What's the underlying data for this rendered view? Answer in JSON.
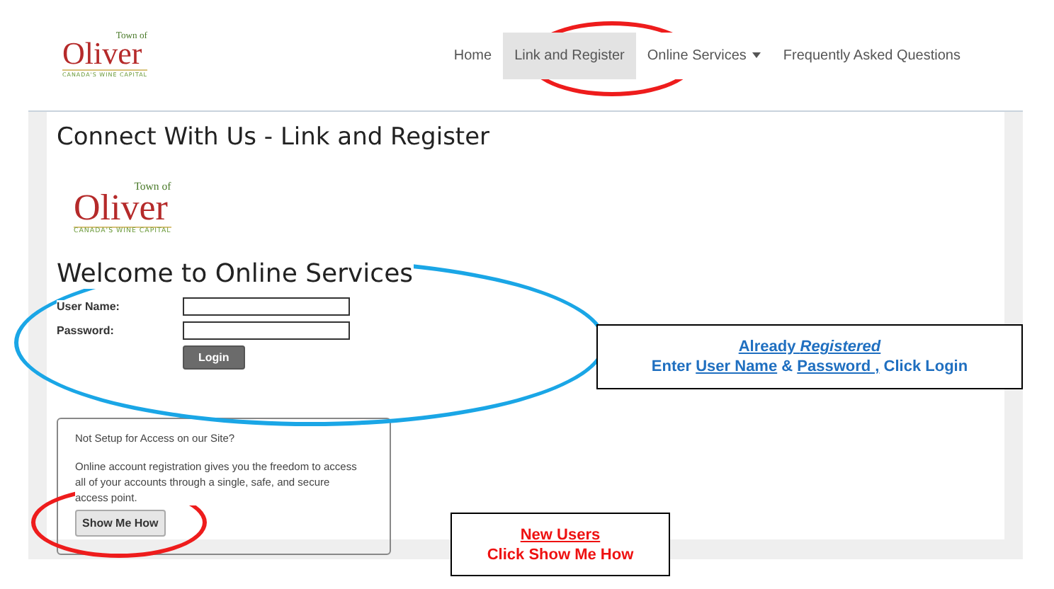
{
  "header": {
    "logo": {
      "town": "Town of",
      "name": "Oliver",
      "tagline": "CANADA'S WINE CAPITAL"
    },
    "nav": [
      {
        "label": "Home",
        "selected": false,
        "dropdown": false
      },
      {
        "label": "Link and Register",
        "selected": true,
        "dropdown": false
      },
      {
        "label": "Online Services",
        "selected": false,
        "dropdown": true
      },
      {
        "label": "Frequently Asked Questions",
        "selected": false,
        "dropdown": false
      }
    ]
  },
  "page": {
    "title": "Connect With Us - Link and Register",
    "logo": {
      "town": "Town of",
      "name": "Oliver",
      "tagline": "CANADA'S WINE CAPITAL"
    },
    "heading": "Welcome to Online Services",
    "form": {
      "fields": [
        {
          "label": "User Name:"
        },
        {
          "label": "Password:"
        }
      ],
      "button": "Login"
    },
    "signup": {
      "question": "Not Setup for Access on our Site?",
      "text": "Online account registration gives you the freedom to access all of your accounts through a single, safe, and secure access point.",
      "button": "Show Me How"
    }
  },
  "annotations": [
    {
      "kind": "oval",
      "color": "#ee1c1c"
    },
    {
      "kind": "oval",
      "color": "#1aa6e6"
    },
    {
      "kind": "oval",
      "color": "#ee1c1c"
    },
    {
      "kind": "callout",
      "color": "#1f6fc0",
      "lines": [
        [
          {
            "text": "Already *Registered*",
            "underlined": true
          }
        ],
        [
          {
            "text": "Enter ",
            "underlined": false
          },
          {
            "text": "User Name",
            "underlined": true
          },
          {
            "text": " & ",
            "underlined": false
          },
          {
            "text": "Password ,",
            "underlined": true
          },
          {
            "text": " Click Login",
            "underlined": false
          }
        ]
      ]
    },
    {
      "kind": "callout",
      "color": "#ee1111",
      "lines": [
        [
          {
            "text": "New Users",
            "underlined": true
          }
        ],
        [
          {
            "text": "Click Show Me How",
            "underlined": false
          }
        ]
      ]
    }
  ]
}
